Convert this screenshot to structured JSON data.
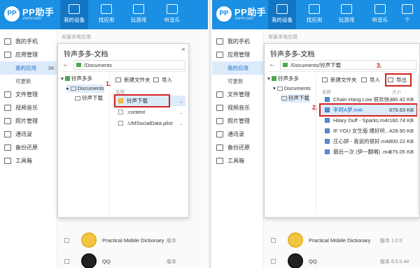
{
  "brand": {
    "name": "PP助手",
    "sub": "25PP.com"
  },
  "nav": [
    "我的设备",
    "找应用",
    "玩游戏",
    "听音乐",
    "个"
  ],
  "sidebar": {
    "my_phone": "我的手机",
    "app_manage": "应用管理",
    "my_apps": "我的应用",
    "my_apps_count": "36",
    "updatable": "可更新",
    "file_manage": "文件管理",
    "video_music": "视频音乐",
    "photo_manage": "照片管理",
    "contacts": "通讯录",
    "backup": "备份还原",
    "toolbox": "工具箱"
  },
  "background": {
    "install_hint": "安装本地应用",
    "apps": [
      {
        "name": "Practical Mobile Dictionary",
        "version_left": "版本",
        "version_right": "版本 1.0.0"
      },
      {
        "name": "QQ",
        "version_left": "版本",
        "version_right": "版本 6.5.0.44"
      }
    ]
  },
  "dialog": {
    "title": "铃声多多-文档",
    "close": "×",
    "back": "←",
    "path_left": "/Documents",
    "path_right": "/Documents/铃声下载",
    "tree_root": "铃声多多",
    "tree_documents": "Documents",
    "tree_ringtone": "铃声下载",
    "new_folder": "新建文件夹",
    "import": "导入",
    "export": "导出",
    "col_name": "名称",
    "col_size": "大小",
    "left_files": [
      {
        "name": "铃声下载",
        "size": ".."
      },
      {
        "name": ".context",
        "size": ".."
      },
      {
        "name": ".UMSocialData.plist",
        "size": ".."
      }
    ],
    "right_files": [
      {
        "name": "Chain Hang Low 很欢快...",
        "size": "380.42 KB"
      },
      {
        "name": "李珂A梦.m4r",
        "size": "679.63 KB"
      },
      {
        "name": "Hilary Duff - Sparks.m4r",
        "size": "160.74 KB"
      },
      {
        "name": "IF YOU 女生版 爆好听...",
        "size": "428.90 KB"
      },
      {
        "name": "庄心妍 - 我说的很好.m4r",
        "size": "300.22 KB"
      },
      {
        "name": "最后一次 (伊一翻唱) .m4r",
        "size": "175.05 KB"
      }
    ]
  },
  "steps": {
    "s1": "1.",
    "s2": "2.",
    "s3": "3."
  }
}
